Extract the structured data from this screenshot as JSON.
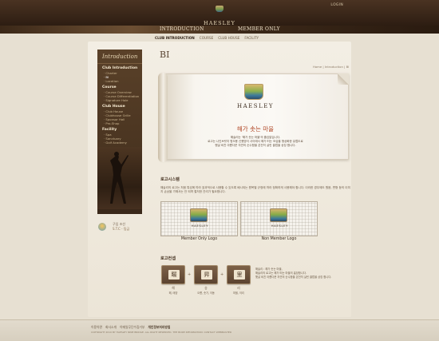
{
  "header": {
    "logo_text": "HAESLEY",
    "login": "LOGIN",
    "nav": [
      {
        "label": "INTRODUCTION"
      },
      {
        "label": "MEMBER ONLY"
      }
    ],
    "subnav": [
      {
        "label": "CLUB INTRODUCTION",
        "active": true
      },
      {
        "label": "COURSE"
      },
      {
        "label": "CLUB HOUSE"
      },
      {
        "label": "FACILITY"
      }
    ]
  },
  "sidebar": {
    "title": "Introduction",
    "sections": [
      {
        "title": "Club Introduction",
        "items": [
          "Charter",
          "BI",
          "Location"
        ]
      },
      {
        "title": "Course",
        "items": [
          "Course Overview",
          "Course Differentiation",
          "Signature Hole"
        ]
      },
      {
        "title": "Club House",
        "items": [
          "Club House",
          "Clubhouse Grille",
          "Sponsor Hall",
          "Pro-Shop"
        ]
      },
      {
        "title": "Facility",
        "items": [
          "Spa",
          "Sanctuary",
          "Golf Academy"
        ]
      }
    ],
    "active_item": "BI",
    "contact": {
      "label": "구입 조선",
      "number": "S.T.C - 팀금"
    }
  },
  "main": {
    "title": "BI",
    "breadcrumb": "Home  |  Introduction  |  BI",
    "hero": {
      "brand": "HAESLEY",
      "slogan": "해가 솟는 마을",
      "desc_lines": [
        "해슬리는 '해가 솟는 마을'의 줄임말입니다.",
        "로고는 나인브릿지 명오용 신했망이 사이에서 해가 떠는 모습을 형상화한 유럽도로",
        "햇살 비친 아름다운 자연의 순수함을 온전히 살린 클럽을 상징 합니다."
      ]
    },
    "logo_system": {
      "heading": "로고시스템",
      "text": "해슬리의 로고는 처음 특성에 따라 효과적으로 사용할 수 있도록 배시되는 원목별 규정에 따라 정확하게 사용해야 합니다. 이러한 경우에도 원음, 변형 등의 이미지 손상을 가해서는 안 되며 철저한 관리가 필요합니다.",
      "logos": [
        {
          "caption": "Member Only Logo",
          "mark_text": "HAESLEY"
        },
        {
          "caption": "Non Member Logo",
          "mark_text": "HAESLEY"
        }
      ]
    },
    "logo_concept": {
      "heading": "로고컨셉",
      "chars": [
        {
          "char": "暘",
          "label": "해",
          "sub": "해, 태양"
        },
        {
          "char": "昇",
          "label": "승",
          "sub": "오름, 솟기, 이동"
        },
        {
          "char": "里",
          "label": "리",
          "sub": "마을, 이리"
        }
      ],
      "text_lines": [
        "해슬리 : 해가 솟는 마을,",
        "해슬리의 로고는 해가 떠는 마을의 홈장합니다.",
        "햇살 비친 아름다운 자연의 순수함을 온전히 살린 클럽을 상징 합니다."
      ]
    }
  },
  "footer": {
    "links": [
      "이용약관",
      "회사소개",
      "이메일무단수집거부",
      "개인정보처리방침"
    ],
    "copyright": "COPYRIGHT 2010 BY HAESLEY NINE BRIDGE. ALL RIGHT RESERVED.  THE BORE INFORMATION: CONTACT WEBMASTER"
  }
}
